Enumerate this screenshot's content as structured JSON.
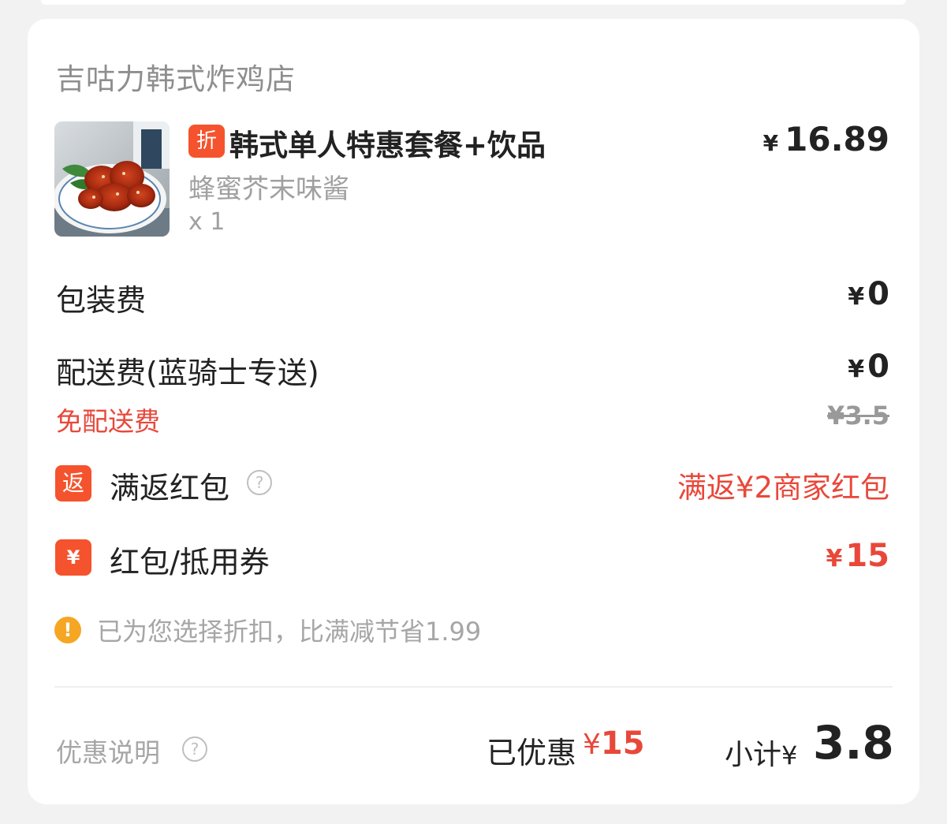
{
  "shop": {
    "name": "吉咕力韩式炸鸡店"
  },
  "item": {
    "badge": "折",
    "title": "韩式单人特惠套餐+饮品",
    "price_currency": "¥",
    "price": "16.89",
    "spec": "蜂蜜芥末味酱",
    "quantity": "x 1",
    "image_icon": "fried-chicken-photo"
  },
  "fees": {
    "packaging_label": "包装费",
    "packaging_currency": "¥",
    "packaging_value": "0",
    "delivery_label": "配送费(蓝骑士专送)",
    "delivery_currency": "¥",
    "delivery_value": "0",
    "free_delivery_text": "免配送费",
    "original_delivery_fee": "¥3.5"
  },
  "rebate": {
    "icon_text": "返",
    "label": "满返红包",
    "help_icon": "?",
    "value": "满返¥2商家红包"
  },
  "coupon": {
    "icon_text": "¥",
    "label": "红包/抵用券",
    "currency": "¥",
    "value": "15"
  },
  "notice": {
    "icon": "!",
    "text": "已为您选择折扣，比满减节省1.99"
  },
  "footer": {
    "promo_label": "优惠说明",
    "help_icon": "?",
    "saved_label": "已优惠",
    "saved_currency": "¥",
    "saved_value": "15",
    "subtotal_label": "小计",
    "subtotal_currency": "¥",
    "subtotal_value": "3.8"
  },
  "colors": {
    "accent_red": "#f5532d",
    "price_red": "#e8483a",
    "warn_orange": "#f5a623",
    "muted_text": "#a6a6a6"
  }
}
